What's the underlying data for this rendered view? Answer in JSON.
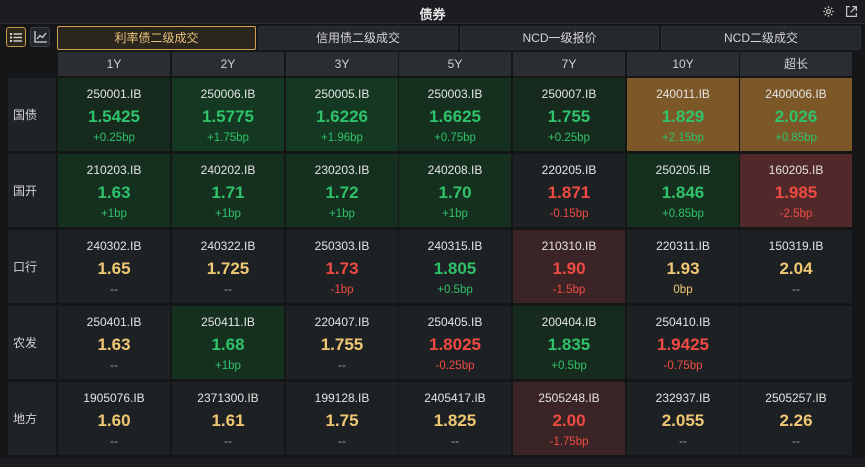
{
  "window": {
    "title": "债券"
  },
  "tabs": [
    {
      "label": "利率债二级成交",
      "active": true
    },
    {
      "label": "信用债二级成交",
      "active": false
    },
    {
      "label": "NCD一级报价",
      "active": false
    },
    {
      "label": "NCD二级成交",
      "active": false
    }
  ],
  "view_buttons": [
    {
      "icon": "list-icon",
      "active": true
    },
    {
      "icon": "chart-icon",
      "active": false
    }
  ],
  "columns": [
    "1Y",
    "2Y",
    "3Y",
    "5Y",
    "7Y",
    "10Y",
    "超长"
  ],
  "colors": {
    "up": "#2fc26a",
    "down": "#ef4b42",
    "neutral": "#f0c874",
    "accent": "#d3a04f"
  },
  "rows": [
    {
      "label": "国债",
      "cells": [
        {
          "code": "250001.IB",
          "value": "1.5425",
          "change": "+0.25bp",
          "bg": "g0",
          "vc": "cg",
          "cc": "cg"
        },
        {
          "code": "250006.IB",
          "value": "1.5775",
          "change": "+1.75bp",
          "bg": "g2",
          "vc": "cg",
          "cc": "cg"
        },
        {
          "code": "250005.IB",
          "value": "1.6226",
          "change": "+1.96bp",
          "bg": "g2",
          "vc": "cg",
          "cc": "cg"
        },
        {
          "code": "250003.IB",
          "value": "1.6625",
          "change": "+0.75bp",
          "bg": "g1",
          "vc": "cg",
          "cc": "cg"
        },
        {
          "code": "250007.IB",
          "value": "1.755",
          "change": "+0.25bp",
          "bg": "g0",
          "vc": "cg",
          "cc": "cg"
        },
        {
          "code": "240011.IB",
          "value": "1.829",
          "change": "+2.15bp",
          "bg": "o1",
          "vc": "cg",
          "cc": "cg"
        },
        {
          "code": "2400006.IB",
          "value": "2.026",
          "change": "+0.85bp",
          "bg": "o1",
          "vc": "cg",
          "cc": "cg"
        }
      ]
    },
    {
      "label": "国开",
      "cells": [
        {
          "code": "210203.IB",
          "value": "1.63",
          "change": "+1bp",
          "bg": "g1",
          "vc": "cg",
          "cc": "cg"
        },
        {
          "code": "240202.IB",
          "value": "1.71",
          "change": "+1bp",
          "bg": "g1",
          "vc": "cg",
          "cc": "cg"
        },
        {
          "code": "230203.IB",
          "value": "1.72",
          "change": "+1bp",
          "bg": "g1",
          "vc": "cg",
          "cc": "cg"
        },
        {
          "code": "240208.IB",
          "value": "1.70",
          "change": "+1bp",
          "bg": "g1",
          "vc": "cg",
          "cc": "cg"
        },
        {
          "code": "220205.IB",
          "value": "1.871",
          "change": "-0.15bp",
          "bg": "n",
          "vc": "cr",
          "cc": "cr"
        },
        {
          "code": "250205.IB",
          "value": "1.846",
          "change": "+0.85bp",
          "bg": "g1",
          "vc": "cg",
          "cc": "cg"
        },
        {
          "code": "160205.IB",
          "value": "1.985",
          "change": "-2.5bp",
          "bg": "r1",
          "vc": "cr",
          "cc": "cr"
        }
      ]
    },
    {
      "label": "口行",
      "cells": [
        {
          "code": "240302.IB",
          "value": "1.65",
          "change": "--",
          "bg": "n",
          "vc": "cy",
          "cc": "cn"
        },
        {
          "code": "240322.IB",
          "value": "1.725",
          "change": "--",
          "bg": "n",
          "vc": "cy",
          "cc": "cn"
        },
        {
          "code": "250303.IB",
          "value": "1.73",
          "change": "-1bp",
          "bg": "n",
          "vc": "cr",
          "cc": "cr"
        },
        {
          "code": "240315.IB",
          "value": "1.805",
          "change": "+0.5bp",
          "bg": "n",
          "vc": "cg",
          "cc": "cg"
        },
        {
          "code": "210310.IB",
          "value": "1.90",
          "change": "-1.5bp",
          "bg": "r0",
          "vc": "cr",
          "cc": "cr"
        },
        {
          "code": "220311.IB",
          "value": "1.93",
          "change": "0bp",
          "bg": "n",
          "vc": "cy",
          "cc": "cy"
        },
        {
          "code": "150319.IB",
          "value": "2.04",
          "change": "--",
          "bg": "n",
          "vc": "cy",
          "cc": "cn"
        }
      ]
    },
    {
      "label": "农发",
      "cells": [
        {
          "code": "250401.IB",
          "value": "1.63",
          "change": "--",
          "bg": "n",
          "vc": "cy",
          "cc": "cn"
        },
        {
          "code": "250411.IB",
          "value": "1.68",
          "change": "+1bp",
          "bg": "g1",
          "vc": "cg",
          "cc": "cg"
        },
        {
          "code": "220407.IB",
          "value": "1.755",
          "change": "--",
          "bg": "n",
          "vc": "cy",
          "cc": "cn"
        },
        {
          "code": "250405.IB",
          "value": "1.8025",
          "change": "-0.25bp",
          "bg": "n",
          "vc": "cr",
          "cc": "cr"
        },
        {
          "code": "200404.IB",
          "value": "1.835",
          "change": "+0.5bp",
          "bg": "g0",
          "vc": "cg",
          "cc": "cg"
        },
        {
          "code": "250410.IB",
          "value": "1.9425",
          "change": "-0.75bp",
          "bg": "n",
          "vc": "cr",
          "cc": "cr"
        },
        {
          "code": "",
          "value": "",
          "change": "",
          "bg": "n",
          "vc": "cy",
          "cc": "cn"
        }
      ]
    },
    {
      "label": "地方",
      "cells": [
        {
          "code": "1905076.IB",
          "value": "1.60",
          "change": "--",
          "bg": "n",
          "vc": "cy",
          "cc": "cn"
        },
        {
          "code": "2371300.IB",
          "value": "1.61",
          "change": "--",
          "bg": "n",
          "vc": "cy",
          "cc": "cn"
        },
        {
          "code": "199128.IB",
          "value": "1.75",
          "change": "--",
          "bg": "n",
          "vc": "cy",
          "cc": "cn"
        },
        {
          "code": "2405417.IB",
          "value": "1.825",
          "change": "--",
          "bg": "n",
          "vc": "cy",
          "cc": "cn"
        },
        {
          "code": "2505248.IB",
          "value": "2.00",
          "change": "-1.75bp",
          "bg": "r0",
          "vc": "cr",
          "cc": "cr"
        },
        {
          "code": "232937.IB",
          "value": "2.055",
          "change": "--",
          "bg": "n",
          "vc": "cy",
          "cc": "cn"
        },
        {
          "code": "2505257.IB",
          "value": "2.26",
          "change": "--",
          "bg": "n",
          "vc": "cy",
          "cc": "cn"
        }
      ]
    }
  ]
}
